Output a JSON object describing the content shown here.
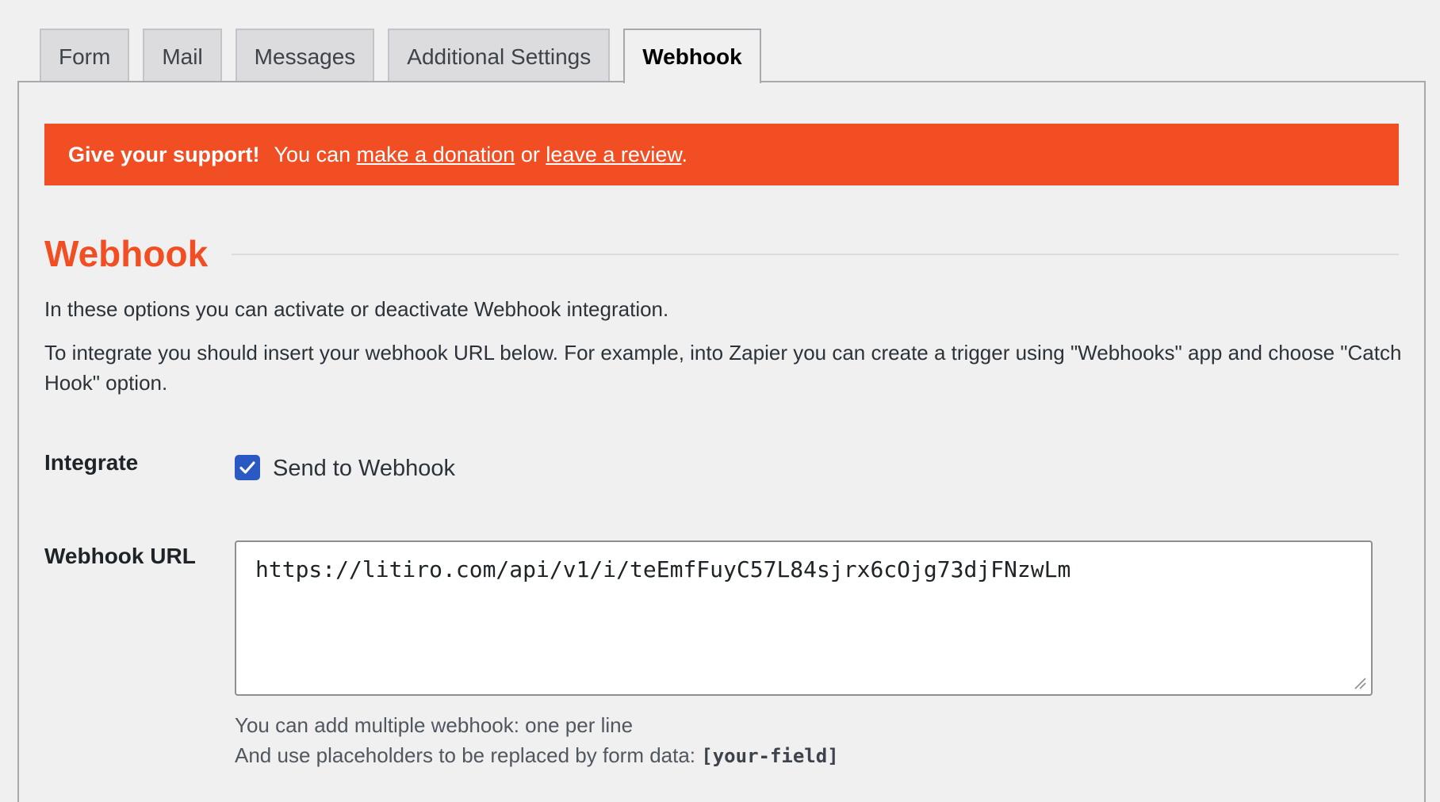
{
  "tabs": [
    {
      "label": "Form",
      "active": false
    },
    {
      "label": "Mail",
      "active": false
    },
    {
      "label": "Messages",
      "active": false
    },
    {
      "label": "Additional Settings",
      "active": false
    },
    {
      "label": "Webhook",
      "active": true
    }
  ],
  "notice": {
    "strong": "Give your support!",
    "prefix": "You can",
    "donation_link": "make a donation",
    "middle": "or",
    "review_link": "leave a review",
    "suffix": ".",
    "background_color": "#f24e23"
  },
  "section": {
    "title": "Webhook",
    "title_color": "#f24e23",
    "description_1": "In these options you can activate or deactivate Webhook integration.",
    "description_2": "To integrate you should insert your webhook URL below. For example, into Zapier you can create a trigger using \"Webhooks\" app and choose \"Catch Hook\" option."
  },
  "integrate": {
    "label": "Integrate",
    "checkbox_label": "Send to Webhook",
    "checked": true,
    "checkbox_color": "#2b59c3"
  },
  "webhook_url": {
    "label": "Webhook URL",
    "value": "https://litiro.com/api/v1/i/teEmfFuyC57L84sjrx6cOjg73djFNzwLm",
    "help_1": "You can add multiple webhook: one per line",
    "help_2_prefix": "And use placeholders to be replaced by form data:",
    "help_2_code": "[your-field]"
  }
}
